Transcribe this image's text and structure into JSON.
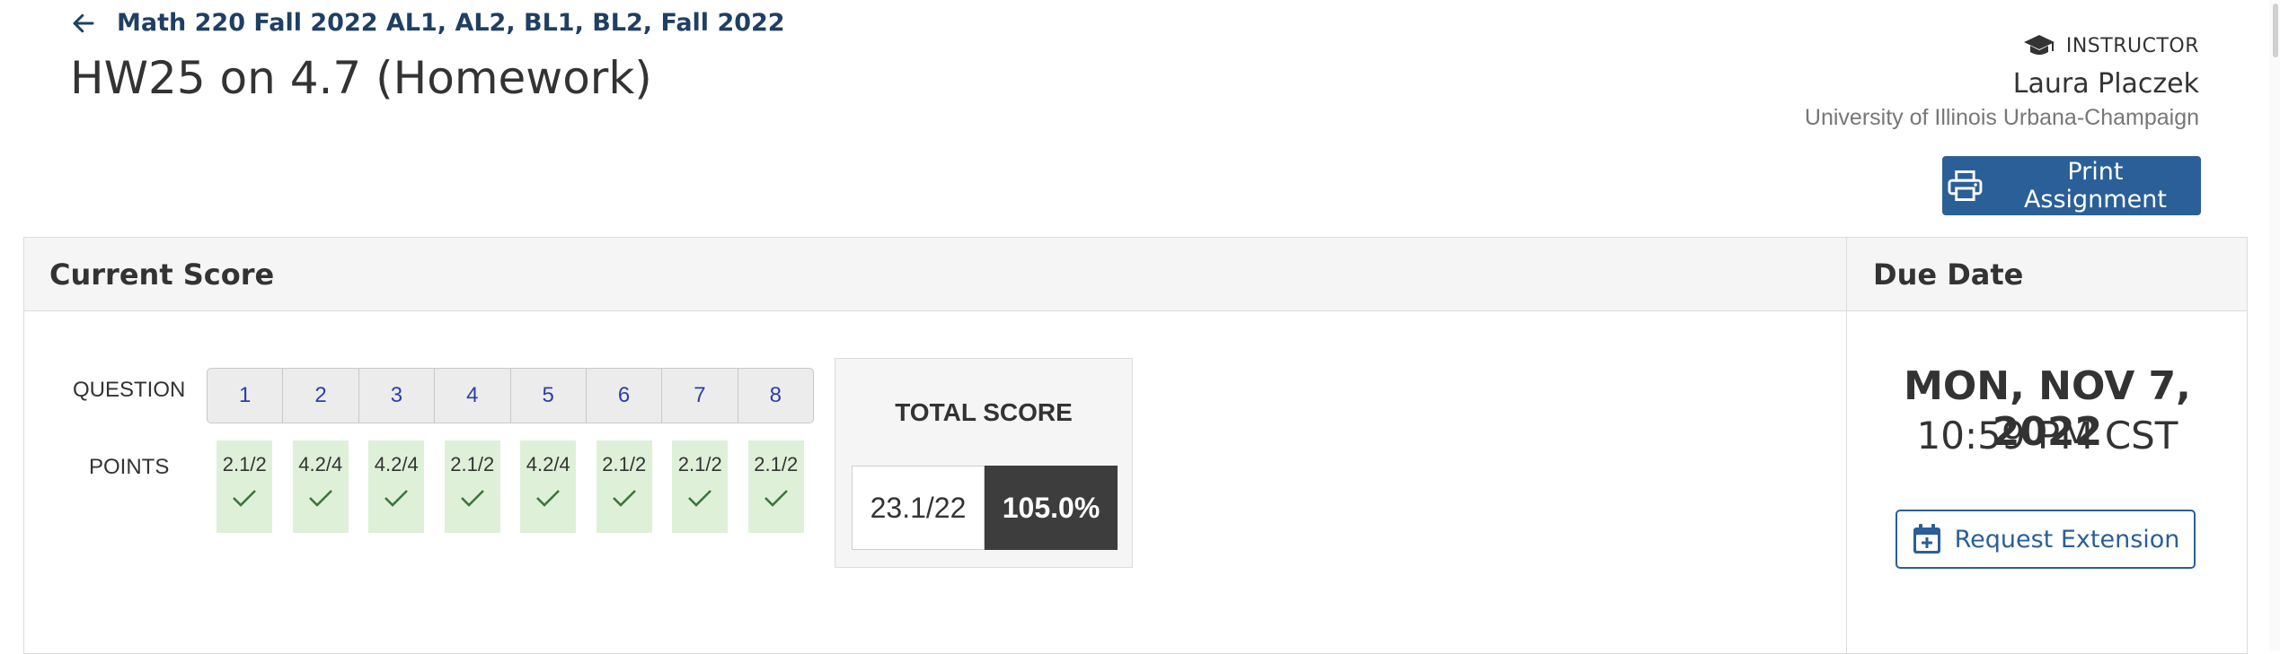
{
  "breadcrumb": {
    "course": "Math 220 Fall 2022 AL1, AL2, BL1, BL2, Fall 2022"
  },
  "page": {
    "title": "HW25 on 4.7 (Homework)"
  },
  "instructor": {
    "label": "INSTRUCTOR",
    "name": "Laura Placzek",
    "school": "University of Illinois Urbana-Champaign"
  },
  "actions": {
    "print_label": "Print Assignment",
    "extension_label": "Request Extension"
  },
  "score": {
    "header": "Current Score",
    "question_label": "QUESTION",
    "points_label": "POINTS",
    "questions": [
      {
        "number": "1",
        "points": "2.1/2",
        "status": "correct"
      },
      {
        "number": "2",
        "points": "4.2/4",
        "status": "correct"
      },
      {
        "number": "3",
        "points": "4.2/4",
        "status": "correct"
      },
      {
        "number": "4",
        "points": "2.1/2",
        "status": "correct"
      },
      {
        "number": "5",
        "points": "4.2/4",
        "status": "correct"
      },
      {
        "number": "6",
        "points": "2.1/2",
        "status": "correct"
      },
      {
        "number": "7",
        "points": "2.1/2",
        "status": "correct"
      },
      {
        "number": "8",
        "points": "2.1/2",
        "status": "correct"
      }
    ],
    "total_title": "TOTAL SCORE",
    "total_points": "23.1/22",
    "total_percent": "105.0%"
  },
  "due": {
    "header": "Due Date",
    "date": "MON, NOV 7, 2022",
    "time": "10:59 PM CST"
  },
  "colors": {
    "brand_blue": "#2a5f98",
    "title_navy": "#1f3f63",
    "correct_bg": "#dff0d8",
    "correct_check": "#3c763d",
    "question_link": "#2a3fa8",
    "percent_bg": "#3d3d3d"
  },
  "icons": {
    "back": "arrow-left-icon",
    "instructor": "graduation-cap-icon",
    "print": "printer-icon",
    "check": "checkmark-icon",
    "extension": "calendar-plus-icon"
  }
}
